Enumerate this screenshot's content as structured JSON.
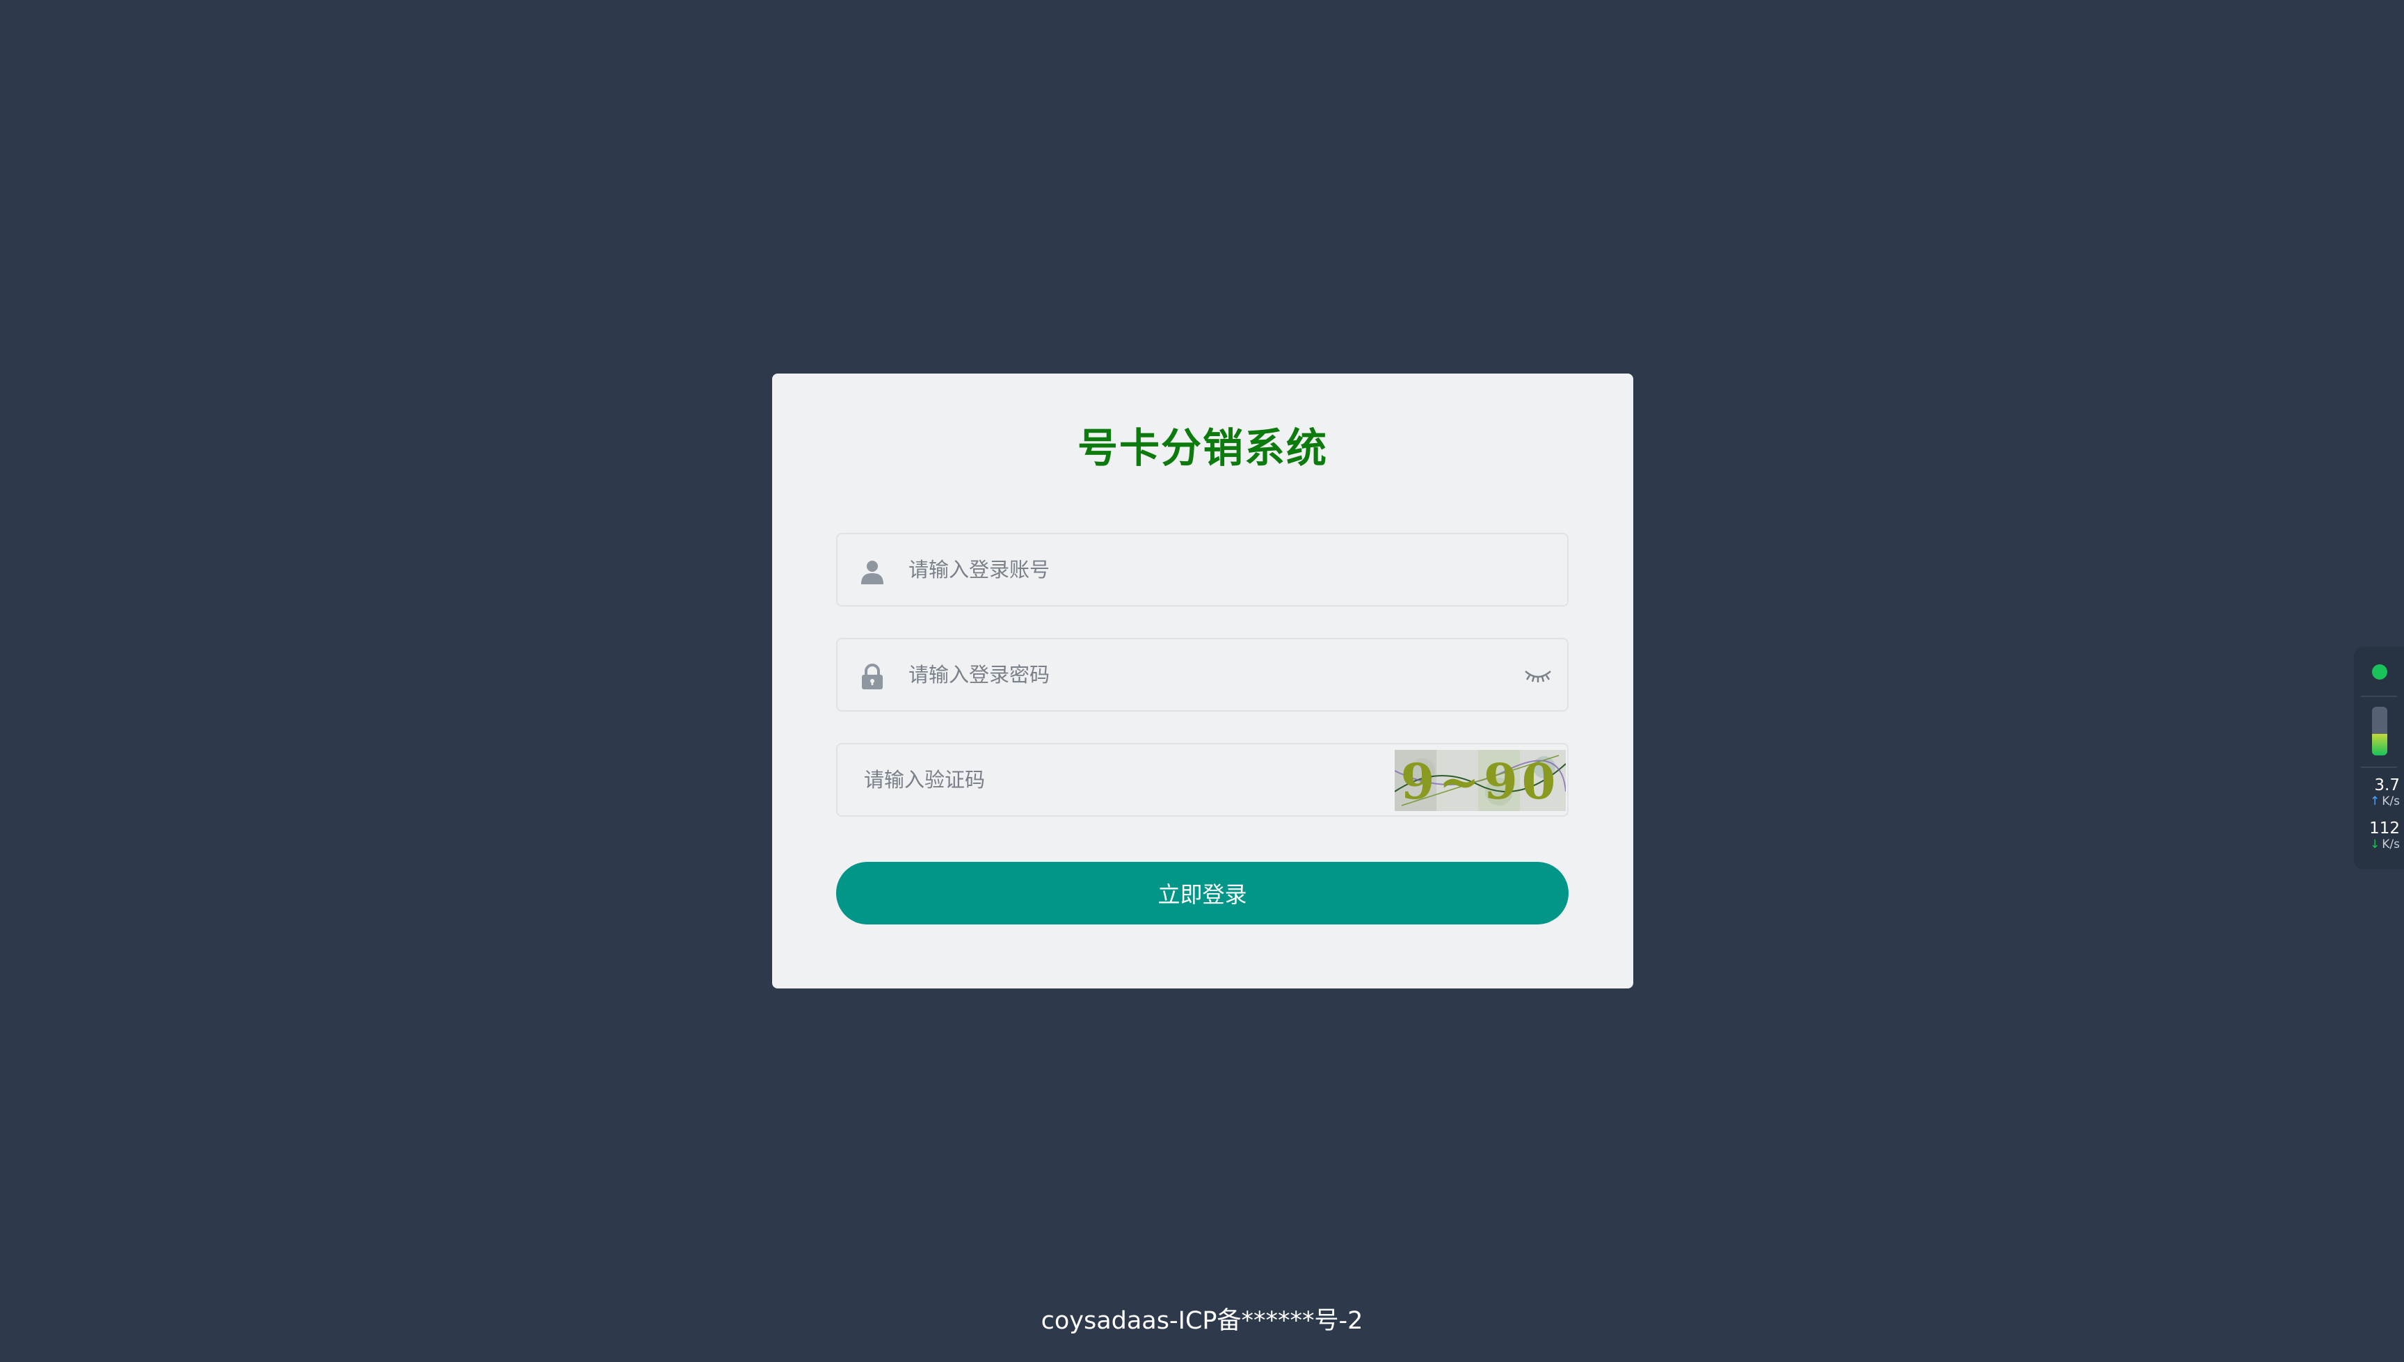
{
  "login": {
    "title": "号卡分销系统",
    "username_placeholder": "请输入登录账号",
    "password_placeholder": "请输入登录密码",
    "captcha_placeholder": "请输入验证码",
    "captcha_chars": "9~90",
    "submit_label": "立即登录"
  },
  "footer": {
    "text": "coysadaas-ICP备******号-2"
  },
  "net_monitor": {
    "upload_value": "3.7",
    "upload_unit": "K/s",
    "download_value": "112",
    "download_unit": "K/s",
    "level_percent": 45
  },
  "colors": {
    "background": "#2e3a4c",
    "card": "#eff1f3",
    "title": "#0c7a0c",
    "button": "#019688",
    "status_dot": "#19c25a"
  },
  "icons": {
    "username": "user-icon",
    "password": "lock-icon",
    "toggle": "eye-closed-icon"
  }
}
